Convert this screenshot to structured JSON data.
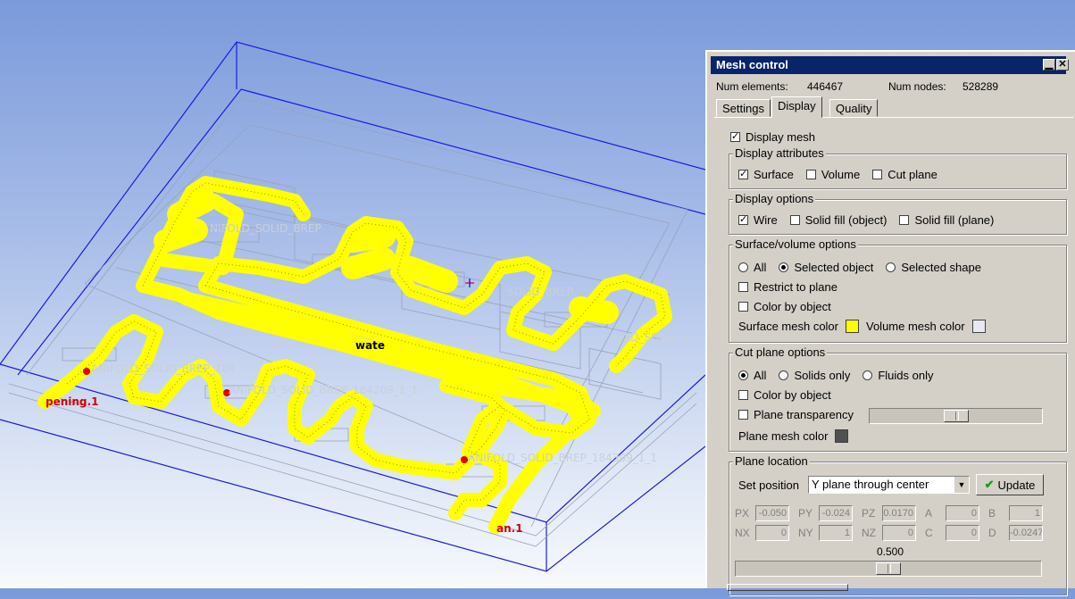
{
  "viewport": {
    "labels": {
      "opening": "pening.1",
      "fan": "an.1",
      "water": "wate",
      "manifold_1": "ANIFOLD_SOLID_BREP_184",
      "manifold_2": "ANIFOLD_SOLID_BREP_184209_1_1",
      "manifold_3": "ANIFOLD_SOLID_BREP_184309_1_1",
      "ghost_1": "NIFOLD_SOLID_BREP",
      "ghost_2": "SOLID_BREP",
      "ghost_3": "OLD_SOLID_B"
    },
    "colors": {
      "mesh": "#ffff00",
      "box": "#1a1ae0",
      "marker": "#e00000"
    }
  },
  "panel": {
    "title": "Mesh control",
    "num_elements_label": "Num elements:",
    "num_elements": "446467",
    "num_nodes_label": "Num nodes:",
    "num_nodes": "528289",
    "tabs": [
      "Settings",
      "Display",
      "Quality"
    ],
    "active_tab": "Display",
    "display_mesh": {
      "label": "Display mesh",
      "checked": true
    },
    "display_attributes": {
      "title": "Display attributes",
      "surface": {
        "label": "Surface",
        "checked": true
      },
      "volume": {
        "label": "Volume",
        "checked": false
      },
      "cut_plane": {
        "label": "Cut plane",
        "checked": false
      }
    },
    "display_options": {
      "title": "Display options",
      "wire": {
        "label": "Wire",
        "checked": true
      },
      "solid_fill_object": {
        "label": "Solid fill (object)",
        "checked": false
      },
      "solid_fill_plane": {
        "label": "Solid fill (plane)",
        "checked": false
      }
    },
    "surface_volume_options": {
      "title": "Surface/volume options",
      "all": "All",
      "selected_object": "Selected object",
      "selected_shape": "Selected shape",
      "selected": "Selected object",
      "restrict_to_plane": {
        "label": "Restrict to plane",
        "checked": false
      },
      "color_by_object": {
        "label": "Color by object",
        "checked": false
      },
      "surface_mesh_color_label": "Surface mesh color",
      "surface_mesh_color": "#ffff00",
      "volume_mesh_color_label": "Volume mesh color",
      "volume_mesh_color": "#e8e8f4"
    },
    "cut_plane_options": {
      "title": "Cut plane options",
      "all": "All",
      "solids_only": "Solids only",
      "fluids_only": "Fluids only",
      "selected": "All",
      "color_by_object": {
        "label": "Color by object",
        "checked": false
      },
      "plane_transparency": {
        "label": "Plane transparency",
        "checked": false,
        "value": 0.5
      },
      "plane_mesh_color_label": "Plane mesh color",
      "plane_mesh_color": "#505050"
    },
    "plane_location": {
      "title": "Plane location",
      "set_position_label": "Set position",
      "set_position_value": "Y plane through center",
      "update_label": "Update",
      "params": [
        {
          "label": "PX",
          "value": "-0.050"
        },
        {
          "label": "PY",
          "value": "-0.024"
        },
        {
          "label": "PZ",
          "value": "0.0170"
        },
        {
          "label": "A",
          "value": "0"
        },
        {
          "label": "B",
          "value": "1"
        },
        {
          "label": "NX",
          "value": "0"
        },
        {
          "label": "NY",
          "value": "1"
        },
        {
          "label": "NZ",
          "value": "0"
        },
        {
          "label": "C",
          "value": "0"
        },
        {
          "label": "D",
          "value": "-0.0247"
        }
      ],
      "slider_value_text": "0.500",
      "slider_value": 0.5
    }
  }
}
